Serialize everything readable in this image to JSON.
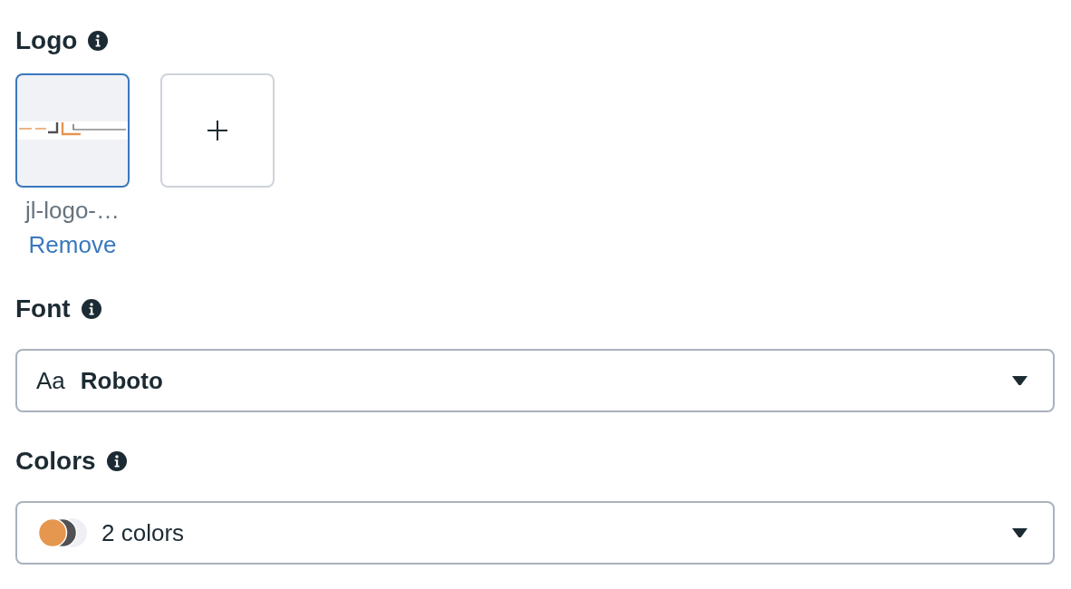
{
  "logo": {
    "label": "Logo",
    "uploads": [
      {
        "filename": "jl-logo-…",
        "action": "Remove",
        "selected": true
      }
    ]
  },
  "font": {
    "label": "Font",
    "sample": "Aa",
    "value": "Roboto"
  },
  "colors": {
    "label": "Colors",
    "swatches": [
      {
        "color": "#e5964f"
      },
      {
        "color": "#515154"
      },
      {
        "color": "#eef0f5"
      }
    ],
    "value": "2 colors"
  }
}
